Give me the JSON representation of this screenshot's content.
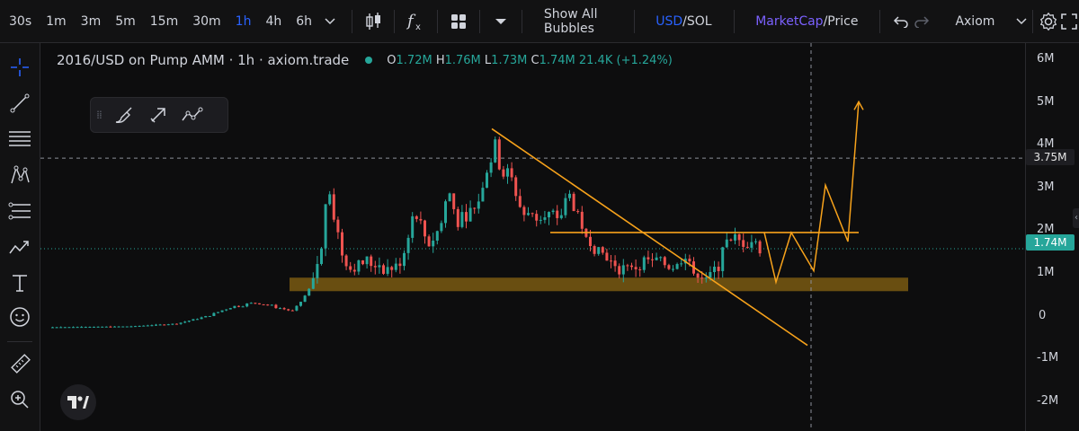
{
  "toolbar": {
    "timeframes": [
      "30s",
      "1m",
      "3m",
      "5m",
      "15m",
      "30m",
      "1h",
      "4h",
      "6h"
    ],
    "active_timeframe": "1h",
    "show_bubbles": "Show All Bubbles",
    "currency_a": "USD",
    "currency_b": "/SOL",
    "mode_a": "MarketCap",
    "mode_b": "/Price",
    "provider": "Axiom"
  },
  "legend": {
    "title": "2016/USD on Pump AMM · 1h · axiom.trade",
    "o_label": "O",
    "o_value": "1.72M",
    "h_label": "H",
    "h_value": "1.76M",
    "l_label": "L",
    "l_value": "1.73M",
    "c_label": "C",
    "c_value": "1.74M",
    "volume": "21.4K",
    "change": "(+1.24%)"
  },
  "axis": {
    "labels": [
      "6M",
      "5M",
      "4M",
      "3M",
      "2M",
      "1M",
      "0",
      "-1M",
      "-2M"
    ],
    "crosshair_value": "3.75M",
    "last_price": "1.74M"
  },
  "chart_data": {
    "type": "candlestick",
    "ylim": [
      -2.3,
      6.3
    ],
    "crosshair_y": 3.75,
    "last_price": 1.74,
    "support_zone": [
      0.8,
      1.1
    ],
    "resistance": 2.1,
    "downtrend_start": 4.4,
    "downtrend_end": -0.4,
    "projection": [
      2.1,
      1.0,
      2.1,
      1.25,
      3.15,
      1.9,
      5.0
    ]
  },
  "colors": {
    "up": "#26a69a",
    "down": "#ef5350",
    "drawing": "#f7a21b",
    "zone": "#7a5a12",
    "accent": "#2962ff"
  },
  "icons": [
    "chevron-down-icon",
    "candles-icon",
    "fx-icon",
    "layout-grid-icon",
    "undo-icon",
    "redo-icon",
    "gear-icon",
    "fullscreen-icon",
    "crosshair-icon",
    "trendline-icon",
    "fib-icon",
    "pattern-icon",
    "projection-icon",
    "brush-icon",
    "text-icon",
    "emoji-icon",
    "ruler-icon",
    "zoom-in-icon",
    "tv-logo-icon"
  ]
}
